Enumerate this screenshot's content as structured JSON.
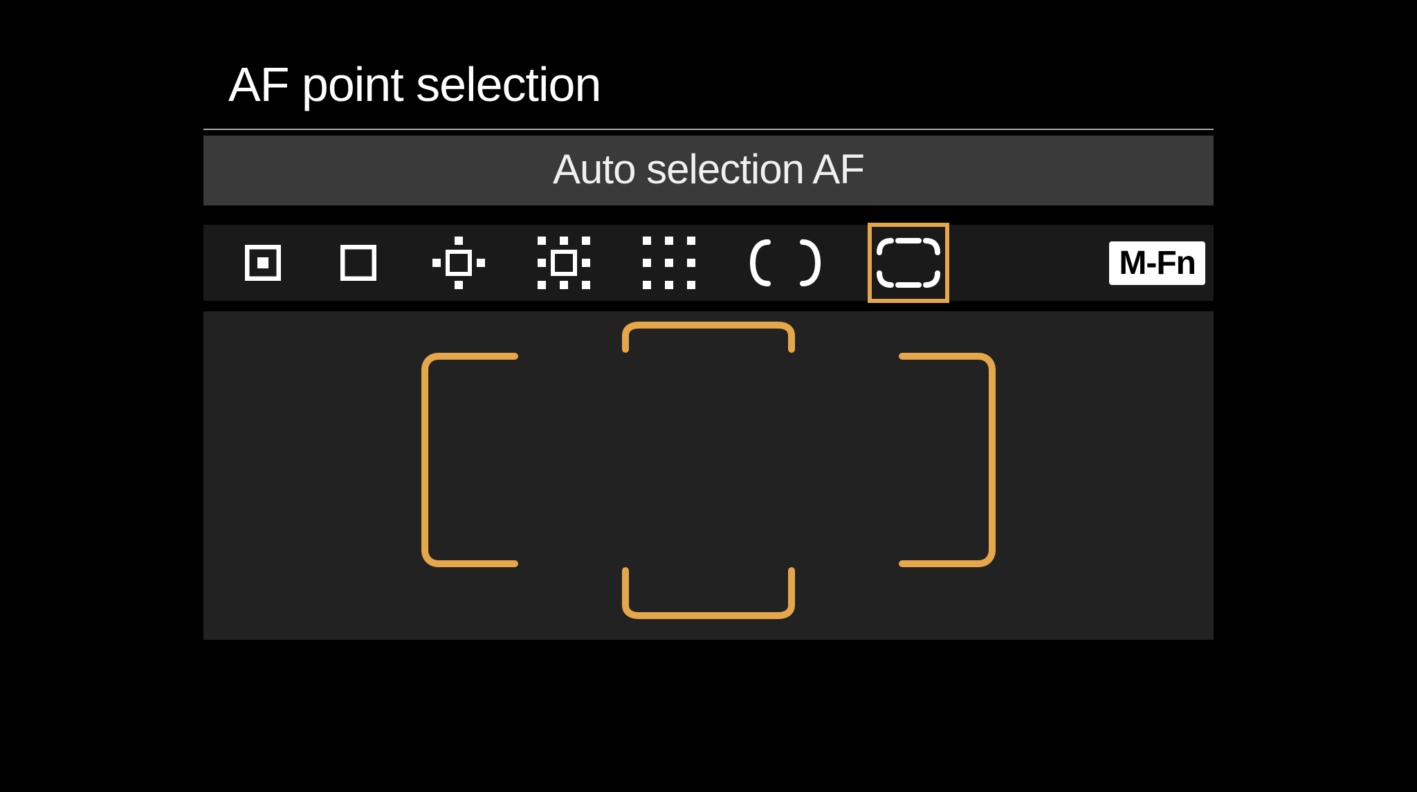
{
  "screen": {
    "title": "AF point selection",
    "subtitle": "Auto selection AF",
    "mfn_label": "M-Fn",
    "accent_color": "#e6a64a",
    "modes": [
      {
        "name": "spot-af",
        "selected": false
      },
      {
        "name": "single-point-af",
        "selected": false
      },
      {
        "name": "expand-af-cross",
        "selected": false
      },
      {
        "name": "expand-af-surround",
        "selected": false
      },
      {
        "name": "zone-af",
        "selected": false
      },
      {
        "name": "large-zone-af",
        "selected": false
      },
      {
        "name": "auto-selection-af",
        "selected": true
      }
    ]
  }
}
